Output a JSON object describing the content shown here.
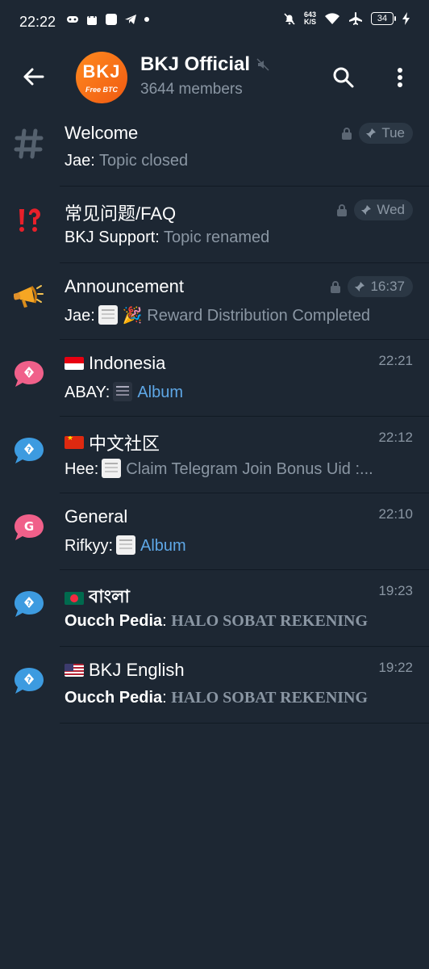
{
  "status_bar": {
    "time": "22:22",
    "net_speed_value": "643",
    "net_speed_unit": "K/S",
    "battery": "34"
  },
  "header": {
    "title": "BKJ Official",
    "subtitle": "3644 members",
    "avatar_logo": "BKJ",
    "avatar_sub": "Free BTC"
  },
  "topics": [
    {
      "name": "Welcome",
      "sender": "Jae:",
      "preview": "Topic closed",
      "time": "Tue"
    },
    {
      "name": "常见问题/FAQ",
      "sender": "BKJ Support:",
      "preview": "Topic renamed",
      "time": "Wed"
    },
    {
      "name": "Announcement",
      "sender": "Jae:",
      "preview": "🎉 Reward Distribution Completed",
      "time": "16:37"
    },
    {
      "name": "Indonesia",
      "sender": "ABAY:",
      "preview": "Album",
      "time": "22:21"
    },
    {
      "name": " 中文社区",
      "sender": "Hee:",
      "preview": "Claim Telegram Join Bonus  Uid :...",
      "time": "22:12"
    },
    {
      "name": "General",
      "sender": "Rifkyy:",
      "preview": "Album",
      "time": "22:10",
      "icon_letter": "G"
    },
    {
      "name": "বাংলা",
      "sender": "Oucch Pedia",
      "preview": "HALO SOBAT REKENING",
      "time": "19:23"
    },
    {
      "name": "BKJ English",
      "sender": "Oucch Pedia",
      "preview": "HALO SOBAT REKENING",
      "time": "19:22"
    }
  ],
  "colors": {
    "background": "#1d2733",
    "secondary_text": "#8a96a3",
    "link": "#5ea7e6",
    "pink_topic": "#f0608a",
    "blue_topic": "#3d9be0",
    "brand_orange": "#f26b17"
  }
}
